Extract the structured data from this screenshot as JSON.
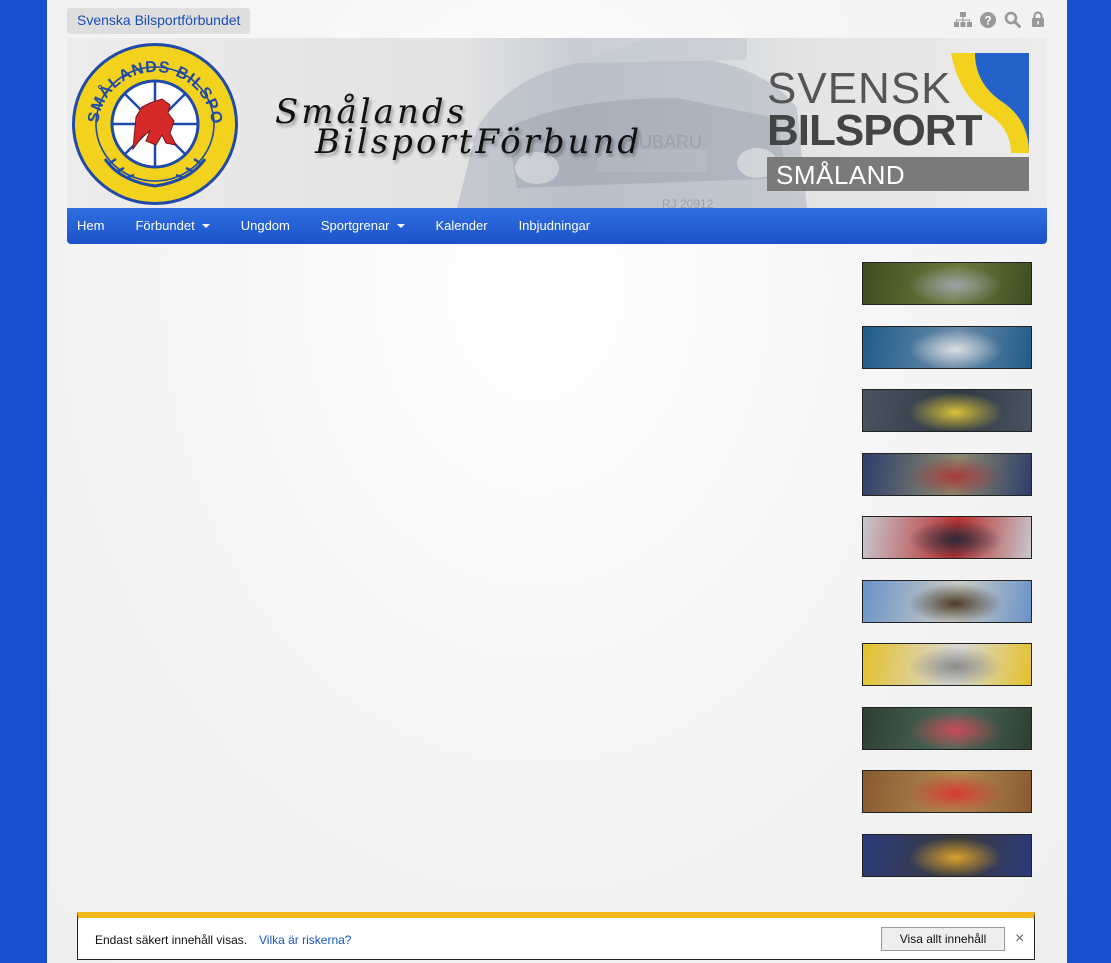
{
  "header": {
    "federation_tab": "Svenska Bilsportförbundet",
    "utility_icons": [
      "sitemap-icon",
      "help-icon",
      "search-icon",
      "lock-icon"
    ]
  },
  "banner": {
    "title_line1": "Smålands",
    "title_line2": "BilsportFörbund",
    "emblem_text": "SMÅLANDS BILSPORTFÖRBUND",
    "brand_line1": "SVENSK",
    "brand_line2": "BILSPORT",
    "brand_line3": "SMÅLAND"
  },
  "nav": {
    "items": [
      {
        "label": "Hem"
      },
      {
        "label": "Förbundet",
        "dropdown": true
      },
      {
        "label": "Ungdom"
      },
      {
        "label": "Sportgrenar",
        "dropdown": true
      },
      {
        "label": "Kalender"
      },
      {
        "label": "Inbjudningar"
      }
    ]
  },
  "sidebar": {
    "thumbnails": [
      {
        "name": "rally-classic-thumb",
        "colors": [
          "#3c4d22",
          "#9aa3a8",
          "#6c7a3c"
        ]
      },
      {
        "name": "drift-blue-thumb",
        "colors": [
          "#1e5c8a",
          "#d8dde2",
          "#6a8aa8"
        ]
      },
      {
        "name": "drift-race-thumb",
        "colors": [
          "#4a5460",
          "#d9c23a",
          "#2f3a44"
        ]
      },
      {
        "name": "folkrace-thumb",
        "colors": [
          "#2e3d6a",
          "#a63a3a",
          "#8a8a70"
        ]
      },
      {
        "name": "karting-thumb",
        "colors": [
          "#c7c9cf",
          "#2a2a38",
          "#b83030"
        ]
      },
      {
        "name": "monster-truck-thumb",
        "colors": [
          "#6a93c8",
          "#4a3a28",
          "#c9cbc4"
        ]
      },
      {
        "name": "racing-yellow-thumb",
        "colors": [
          "#e4c22a",
          "#8a8a8a",
          "#d8d8d8"
        ]
      },
      {
        "name": "racing-grass-thumb",
        "colors": [
          "#2e3f30",
          "#c84a5a",
          "#4a6a58"
        ]
      },
      {
        "name": "rally-red-thumb",
        "colors": [
          "#8a5a30",
          "#d43a2e",
          "#b08a50"
        ]
      },
      {
        "name": "rallycross-thumb",
        "colors": [
          "#2a3a7a",
          "#d8a02e",
          "#3a3a3a"
        ]
      }
    ]
  },
  "security_notice": {
    "message": "Endast säkert innehåll visas.",
    "link": "Vilka är riskerna?",
    "button": "Visa allt innehåll",
    "close": "×"
  },
  "colors": {
    "page_background": "#1a50d0",
    "nav_background": "#2563d9",
    "notice_border": "#f2b51c",
    "emblem_yellow": "#f2d21c",
    "emblem_blue": "#1f4aa8",
    "emblem_red": "#d62a2a"
  }
}
